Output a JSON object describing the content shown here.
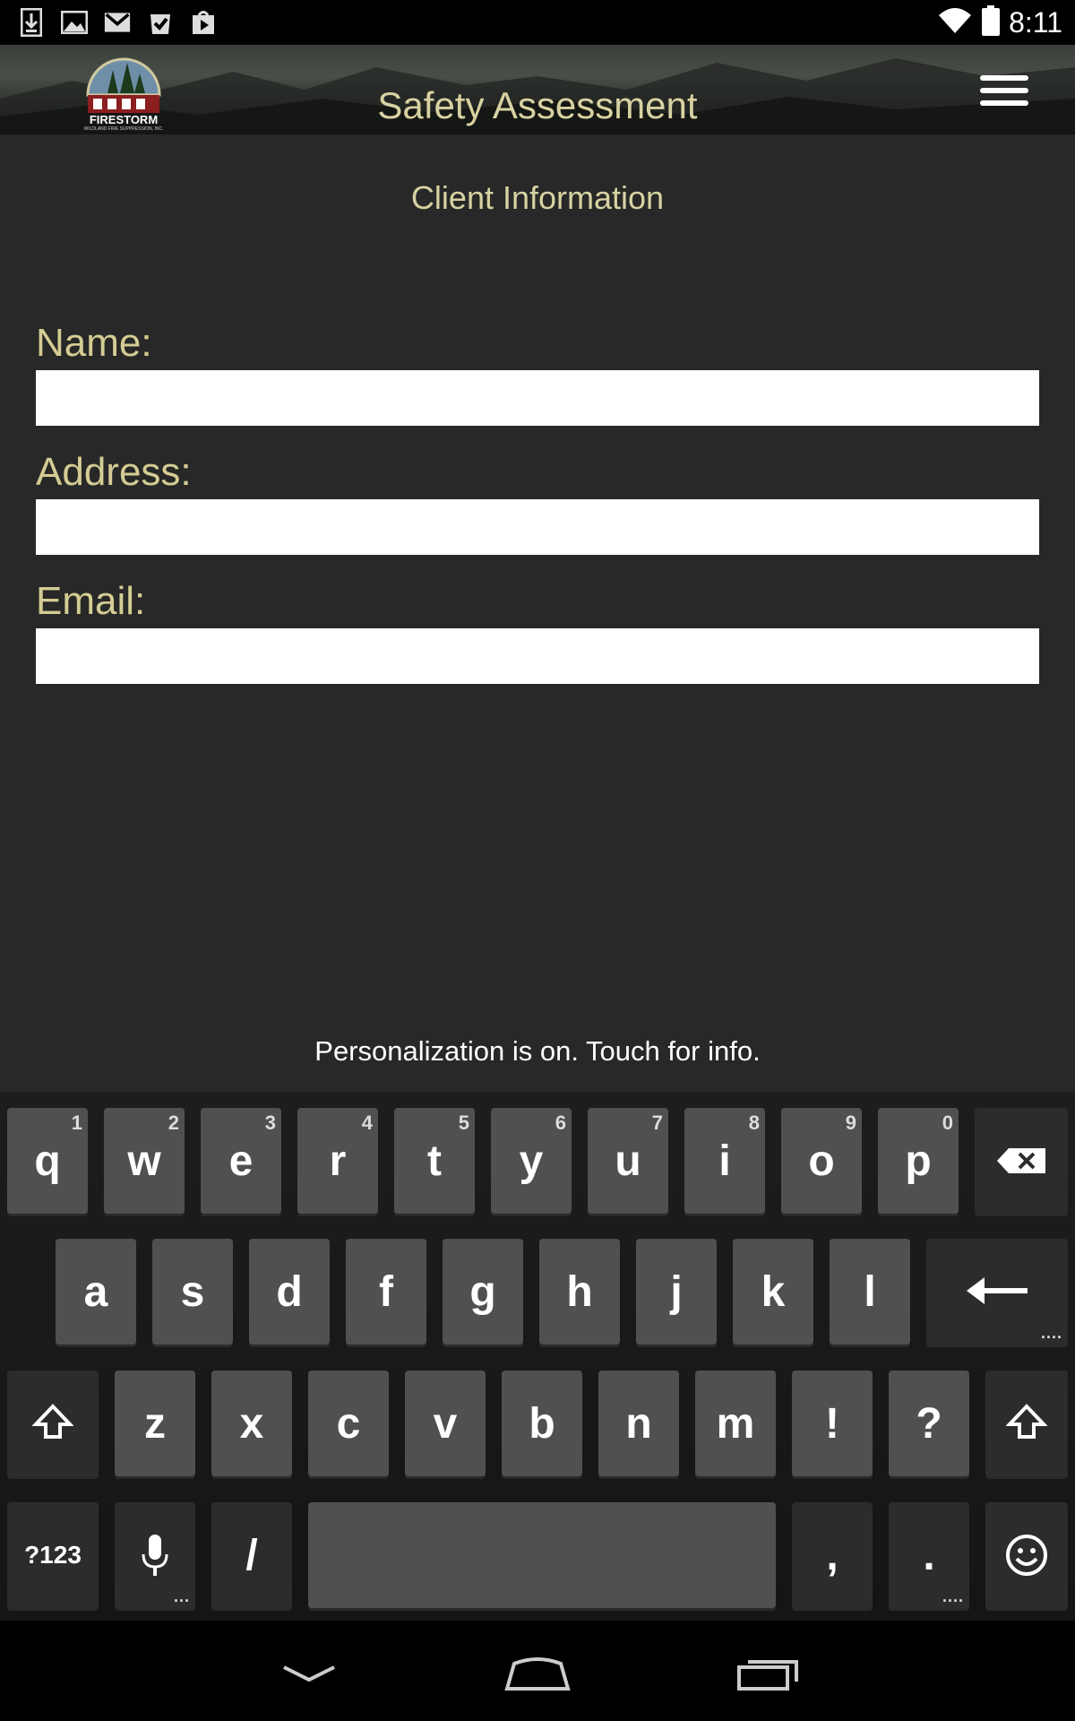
{
  "status_bar": {
    "left_icons": [
      "download-icon",
      "image-icon",
      "gmail-icon",
      "tasks-icon",
      "play-store-icon"
    ],
    "time": "8:11"
  },
  "header": {
    "logo_text": "FIRESTORM",
    "logo_subtext": "WILDLAND FIRE SUPPRESSION, INC.",
    "title": "Safety Assessment"
  },
  "form": {
    "section_title": "Client Information",
    "fields": [
      {
        "label": "Name:",
        "value": ""
      },
      {
        "label": "Address:",
        "value": ""
      },
      {
        "label": "Email:",
        "value": ""
      }
    ]
  },
  "keyboard": {
    "suggestion": "Personalization is on. Touch for info.",
    "row1": [
      {
        "key": "q",
        "hint": "1"
      },
      {
        "key": "w",
        "hint": "2"
      },
      {
        "key": "e",
        "hint": "3"
      },
      {
        "key": "r",
        "hint": "4"
      },
      {
        "key": "t",
        "hint": "5"
      },
      {
        "key": "y",
        "hint": "6"
      },
      {
        "key": "u",
        "hint": "7"
      },
      {
        "key": "i",
        "hint": "8"
      },
      {
        "key": "o",
        "hint": "9"
      },
      {
        "key": "p",
        "hint": "0"
      }
    ],
    "row2": [
      "a",
      "s",
      "d",
      "f",
      "g",
      "h",
      "j",
      "k",
      "l"
    ],
    "row3": [
      "z",
      "x",
      "c",
      "v",
      "b",
      "n",
      "m",
      "!",
      "?"
    ],
    "row4": {
      "symbols": "?123",
      "slash": "/",
      "comma": ",",
      "period": "."
    }
  },
  "colors": {
    "accent_text": "#d4cc94",
    "background": "#272827",
    "key": "#4f5050"
  }
}
